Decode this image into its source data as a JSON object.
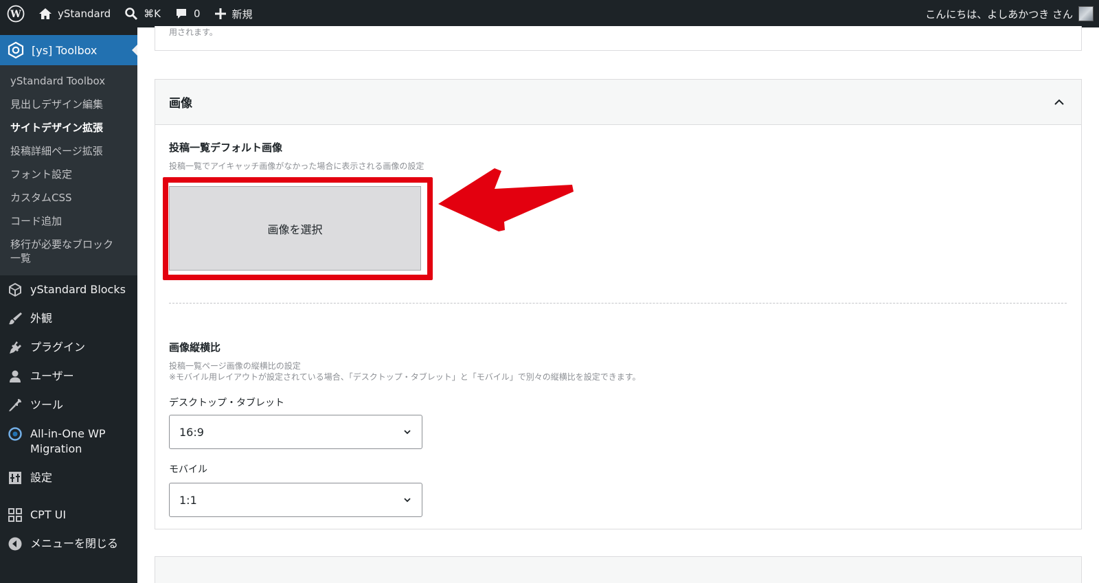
{
  "adminbar": {
    "site_name": "yStandard",
    "search_shortcut": "⌘K",
    "comments_count": "0",
    "new_label": "新規",
    "greeting": "こんにちは、よしあかつき さん"
  },
  "sidebar": {
    "toolbox_label": "[ys] Toolbox",
    "submenu": [
      {
        "label": "yStandard Toolbox"
      },
      {
        "label": "見出しデザイン編集"
      },
      {
        "label": "サイトデザイン拡張"
      },
      {
        "label": "投稿詳細ページ拡張"
      },
      {
        "label": "フォント設定"
      },
      {
        "label": "カスタムCSS"
      },
      {
        "label": "コード追加"
      },
      {
        "label": "移行が必要なブロック一覧"
      }
    ],
    "menu": [
      {
        "label": "yStandard Blocks",
        "icon": "cube-icon"
      },
      {
        "label": "外観",
        "icon": "paintbrush-icon"
      },
      {
        "label": "プラグイン",
        "icon": "plugin-icon"
      },
      {
        "label": "ユーザー",
        "icon": "user-icon"
      },
      {
        "label": "ツール",
        "icon": "wrench-icon"
      },
      {
        "label": "All-in-One WP Migration",
        "icon": "migration-icon"
      },
      {
        "label": "設定",
        "icon": "settings-icon"
      },
      {
        "label": "CPT UI",
        "icon": "grid-icon"
      },
      {
        "label": "メニューを閉じる",
        "icon": "collapse-icon"
      }
    ]
  },
  "main": {
    "prev_panel_text": "用されます。",
    "panel": {
      "title": "画像",
      "default_image": {
        "label": "投稿一覧デフォルト画像",
        "help": "投稿一覧でアイキャッチ画像がなかった場合に表示される画像の設定",
        "button_label": "画像を選択"
      },
      "aspect_ratio": {
        "label": "画像縦横比",
        "help1": "投稿一覧ページ画像の縦横比の設定",
        "help2": "※モバイル用レイアウトが設定されている場合、「デスクトップ・タブレット」と「モバイル」で別々の縦横比を設定できます。",
        "desktop_label": "デスクトップ・タブレット",
        "desktop_value": "16:9",
        "mobile_label": "モバイル",
        "mobile_value": "1:1"
      }
    }
  },
  "colors": {
    "admin_dark": "#1d2327",
    "accent": "#2271b1",
    "highlight_red": "#e3000f"
  }
}
